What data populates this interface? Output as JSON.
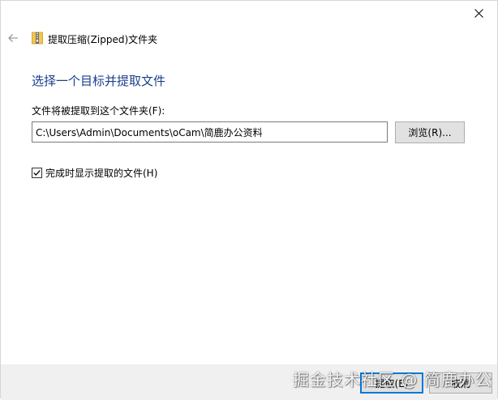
{
  "window": {
    "title": "提取压缩(Zipped)文件夹"
  },
  "main": {
    "heading": "选择一个目标并提取文件",
    "destination_label": "文件将被提取到这个文件夹(F):",
    "destination_value": "C:\\Users\\Admin\\Documents\\oCam\\简鹿办公资料",
    "browse_label": "浏览(R)...",
    "show_files_label": "完成时显示提取的文件(H)",
    "show_files_checked": true
  },
  "footer": {
    "extract_label": "提取(E)",
    "cancel_label": "取消"
  },
  "watermark": {
    "text": "掘金技术社区 @ 简鹿办公"
  },
  "colors": {
    "heading": "#1a3e8c",
    "accent": "#0078d7",
    "footer_bg": "#f0f0f0"
  },
  "icons": {
    "back": "back-arrow-icon",
    "zip": "zip-folder-icon",
    "close": "close-icon",
    "check": "checkmark-icon"
  }
}
